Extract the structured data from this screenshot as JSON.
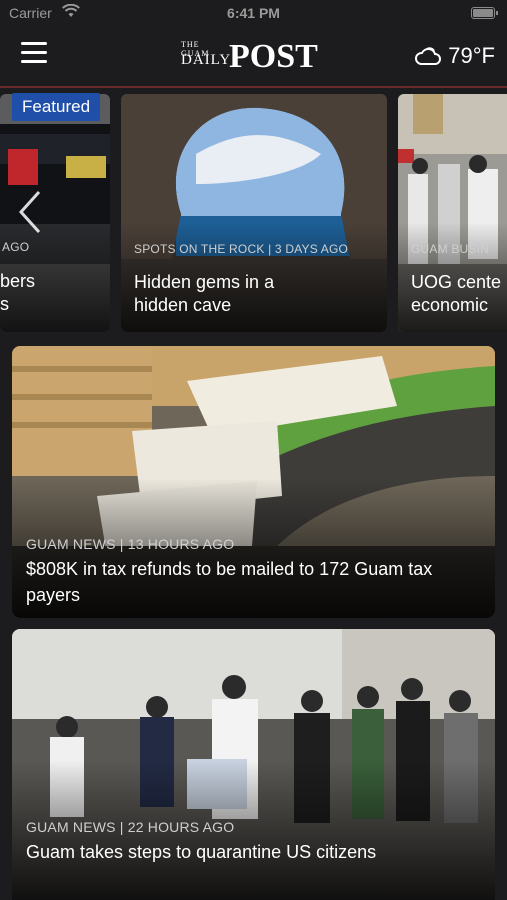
{
  "status_bar": {
    "carrier": "Carrier",
    "time": "6:41 PM"
  },
  "header": {
    "logo_small": "THE GUAM",
    "logo_daily": "DAILY",
    "logo_post": "POST",
    "weather_icon": "cloud-icon",
    "temperature": "79°F"
  },
  "carousel": {
    "featured_label": "Featured",
    "slides": [
      {
        "meta": "AGO",
        "title_line1": "bers",
        "title_line2": "s"
      },
      {
        "meta": "SPOTS ON THE ROCK | 3 DAYS AGO",
        "title_line1": "Hidden gems in a",
        "title_line2": "hidden cave"
      },
      {
        "meta": "GUAM BUSIN",
        "title_line1": "UOG cente",
        "title_line2": "economic"
      }
    ]
  },
  "articles": [
    {
      "meta": "GUAM NEWS | 13 HOURS AGO",
      "title": "$808K in tax refunds to be mailed to 172 Guam tax payers"
    },
    {
      "meta": "GUAM NEWS | 22 HOURS AGO",
      "title": "Guam takes steps to quarantine US citizens"
    }
  ]
}
